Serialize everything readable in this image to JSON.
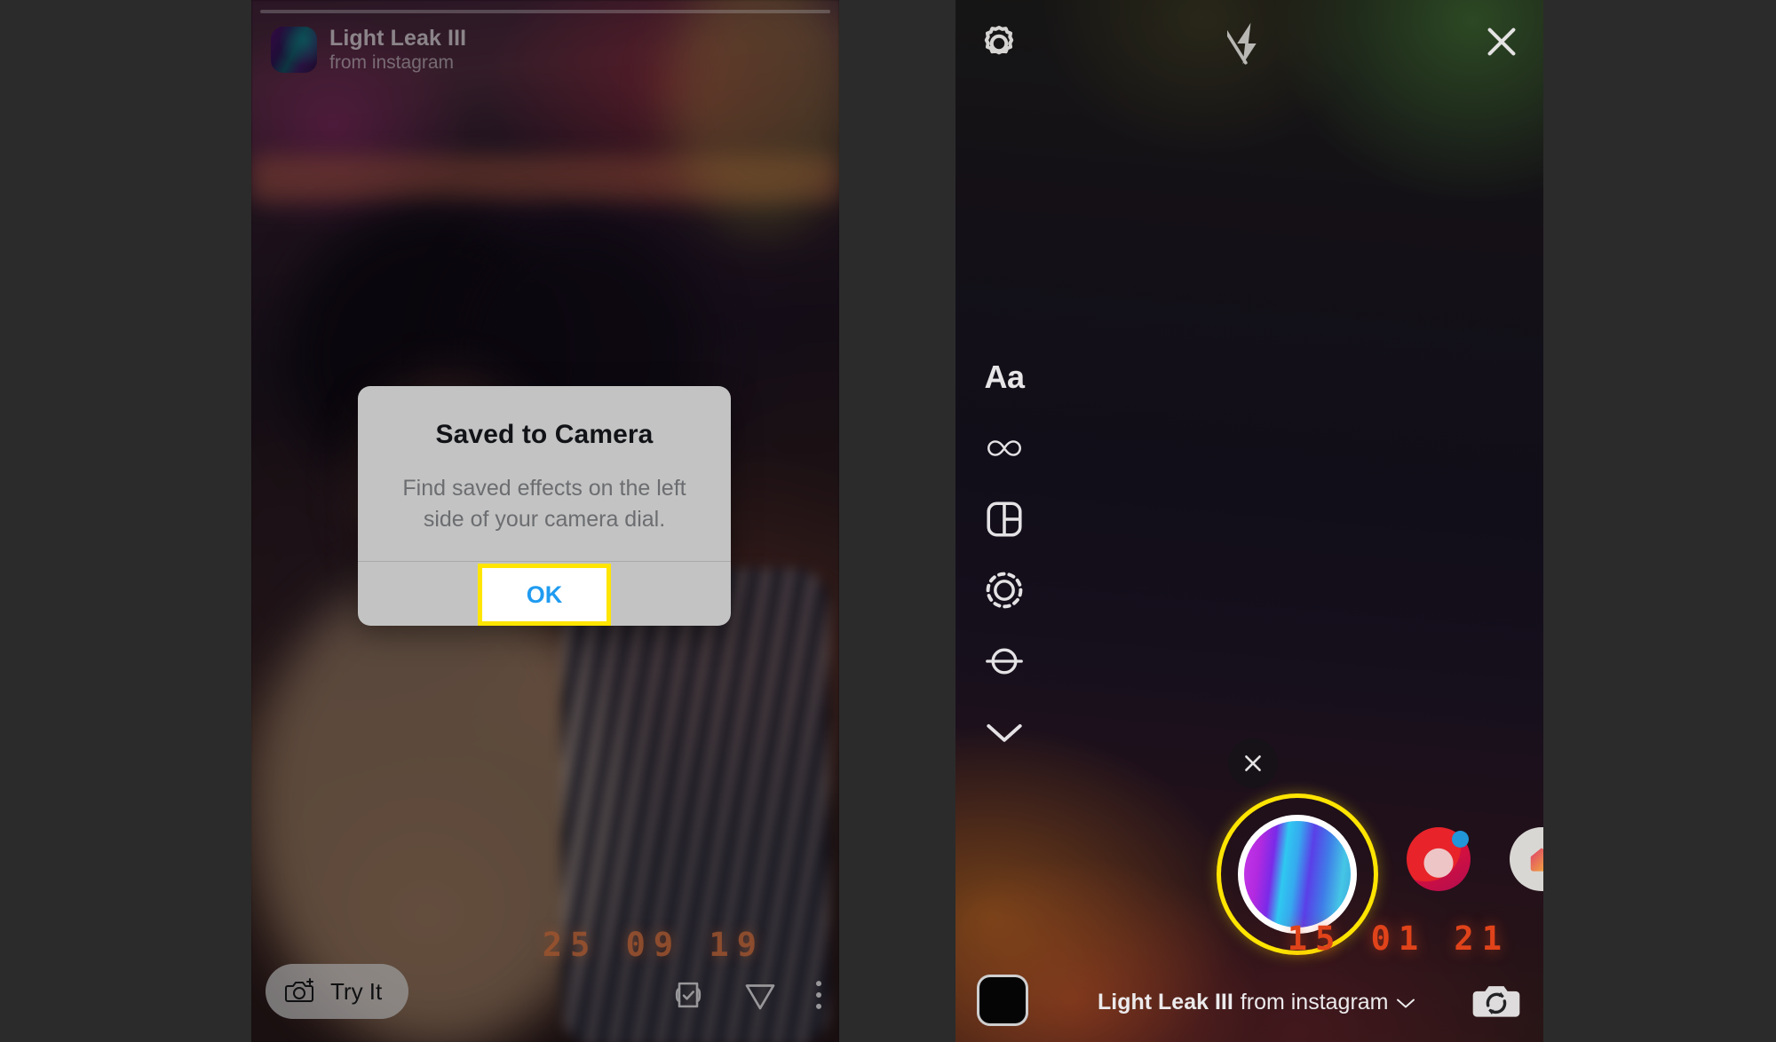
{
  "left_panel": {
    "effect": {
      "name": "Light Leak III",
      "source": "from instagram",
      "thumbnail_icon": "effect-thumbnail"
    },
    "date_overlay": "25 09 19",
    "try_it_label": "Try It",
    "actions": [
      {
        "icon": "save-checkbox-icon",
        "name": "save-effect-button"
      },
      {
        "icon": "send-paper-plane-icon",
        "name": "send-button"
      },
      {
        "icon": "more-options-kebab-icon",
        "name": "more-options-button"
      }
    ],
    "try_it_icon": "camera-sparkle-icon",
    "progress_icon": "story-progress-bar"
  },
  "modal": {
    "title": "Saved to Camera",
    "message": "Find saved effects on the left side of your camera dial.",
    "ok_label": "OK",
    "highlight_color": "#ffe500",
    "ok_text_color": "#1f9bf0"
  },
  "right_panel": {
    "top_bar": [
      {
        "icon": "settings-gear-icon",
        "name": "settings-button"
      },
      {
        "icon": "flash-off-icon",
        "name": "flash-toggle-button"
      },
      {
        "icon": "close-x-icon",
        "name": "close-camera-button"
      }
    ],
    "tools": [
      {
        "icon": "text-aa-icon",
        "label": "Aa",
        "name": "tool-text"
      },
      {
        "icon": "infinity-boomerang-icon",
        "label": "",
        "name": "tool-boomerang"
      },
      {
        "icon": "layout-grid-icon",
        "label": "",
        "name": "tool-layout"
      },
      {
        "icon": "superzoom-dotted-circle-icon",
        "label": "",
        "name": "tool-superzoom"
      },
      {
        "icon": "hands-free-circle-icon",
        "label": "",
        "name": "tool-hands-free"
      },
      {
        "icon": "chevron-down-icon",
        "label": "",
        "name": "tool-expand-more"
      }
    ],
    "clear_effect_icon": "close-x-icon",
    "carousel": [
      {
        "name": "capture-button-light-leak",
        "selected": true,
        "icon": "light-leak-gradient-thumb"
      },
      {
        "name": "effect-thumb-red",
        "selected": false,
        "icon": "red-sparkle-effect-thumb"
      },
      {
        "name": "effect-thumb-home",
        "selected": false,
        "icon": "home-icon"
      }
    ],
    "date_overlay": "15 01 21",
    "caption_name": "Light Leak III",
    "caption_source": "from instagram",
    "caption_chevron_icon": "chevron-down-icon",
    "gallery_thumb_icon": "gallery-thumbnail",
    "flip_camera_icon": "camera-flip-icon",
    "accent_color": "#ffe500"
  }
}
